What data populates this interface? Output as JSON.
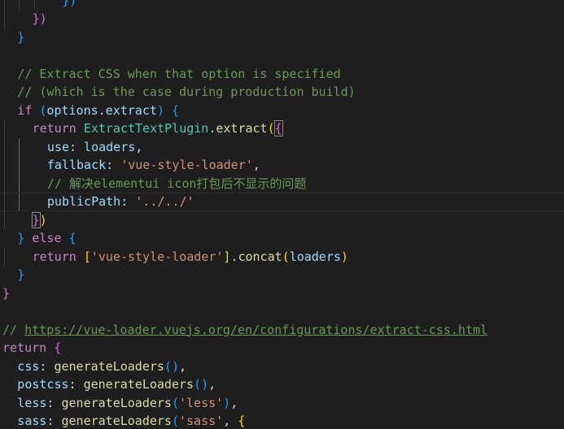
{
  "editor": {
    "language": "javascript",
    "colors": {
      "background": "#1e1e1e",
      "comment": "#6a9955",
      "keyword": "#c586c0",
      "variable": "#9cdcfe",
      "function": "#dcdcaa",
      "class": "#4ec9b0",
      "string": "#ce9178",
      "punctuation": "#d4d4d4",
      "bracket_level_1": "#ffd700",
      "bracket_level_2": "#da70d6",
      "bracket_level_3": "#179fff"
    },
    "lines": [
      {
        "indent": 4,
        "tokens": [
          {
            "t": "})",
            "c": "bracket3"
          }
        ]
      },
      {
        "indent": 2,
        "tokens": [
          {
            "t": "})",
            "c": "bracket2"
          }
        ]
      },
      {
        "indent": 1,
        "tokens": [
          {
            "t": "}",
            "c": "bracket3"
          }
        ]
      },
      {
        "indent": 0,
        "tokens": []
      },
      {
        "indent": 1,
        "tokens": [
          {
            "t": "// Extract CSS when that option is specified",
            "c": "comment"
          }
        ]
      },
      {
        "indent": 1,
        "tokens": [
          {
            "t": "// (which is the case during production build)",
            "c": "comment"
          }
        ]
      },
      {
        "indent": 1,
        "tokens": [
          {
            "t": "if",
            "c": "keyword"
          },
          {
            "t": " ",
            "c": "punct"
          },
          {
            "t": "(",
            "c": "bracket3"
          },
          {
            "t": "options",
            "c": "variable"
          },
          {
            "t": ".",
            "c": "punct"
          },
          {
            "t": "extract",
            "c": "variable"
          },
          {
            "t": ")",
            "c": "bracket3"
          },
          {
            "t": " ",
            "c": "punct"
          },
          {
            "t": "{",
            "c": "bracket3"
          }
        ]
      },
      {
        "indent": 2,
        "tokens": [
          {
            "t": "return",
            "c": "keyword"
          },
          {
            "t": " ",
            "c": "punct"
          },
          {
            "t": "ExtractTextPlugin",
            "c": "class"
          },
          {
            "t": ".",
            "c": "punct"
          },
          {
            "t": "extract",
            "c": "function"
          },
          {
            "t": "(",
            "c": "bracket1"
          },
          {
            "t": "{",
            "c": "bracket2",
            "m": true
          }
        ]
      },
      {
        "indent": 3,
        "tokens": [
          {
            "t": "use",
            "c": "variable"
          },
          {
            "t": ": ",
            "c": "punct"
          },
          {
            "t": "loaders",
            "c": "variable"
          },
          {
            "t": ",",
            "c": "punct"
          }
        ]
      },
      {
        "indent": 3,
        "tokens": [
          {
            "t": "fallback",
            "c": "variable"
          },
          {
            "t": ": ",
            "c": "punct"
          },
          {
            "t": "'vue-style-loader'",
            "c": "string"
          },
          {
            "t": ",",
            "c": "punct"
          }
        ]
      },
      {
        "indent": 3,
        "tokens": [
          {
            "t": "// 解决elementui icon打包后不显示的问题",
            "c": "comment"
          }
        ]
      },
      {
        "indent": 3,
        "current": true,
        "tokens": [
          {
            "t": "publicPath",
            "c": "variable"
          },
          {
            "t": ": ",
            "c": "punct"
          },
          {
            "t": "'../../'",
            "c": "string"
          }
        ]
      },
      {
        "indent": 2,
        "tokens": [
          {
            "t": "}",
            "c": "bracket2",
            "m": true
          },
          {
            "t": ")",
            "c": "bracket1"
          }
        ]
      },
      {
        "indent": 1,
        "tokens": [
          {
            "t": "}",
            "c": "bracket3"
          },
          {
            "t": " ",
            "c": "punct"
          },
          {
            "t": "else",
            "c": "keyword"
          },
          {
            "t": " ",
            "c": "punct"
          },
          {
            "t": "{",
            "c": "bracket3"
          }
        ]
      },
      {
        "indent": 2,
        "tokens": [
          {
            "t": "return",
            "c": "keyword"
          },
          {
            "t": " ",
            "c": "punct"
          },
          {
            "t": "[",
            "c": "bracket1"
          },
          {
            "t": "'vue-style-loader'",
            "c": "string"
          },
          {
            "t": "]",
            "c": "bracket1"
          },
          {
            "t": ".",
            "c": "punct"
          },
          {
            "t": "concat",
            "c": "function"
          },
          {
            "t": "(",
            "c": "bracket1"
          },
          {
            "t": "loaders",
            "c": "variable"
          },
          {
            "t": ")",
            "c": "bracket1"
          }
        ]
      },
      {
        "indent": 1,
        "tokens": [
          {
            "t": "}",
            "c": "bracket3"
          }
        ]
      },
      {
        "indent": 0,
        "tokens": [
          {
            "t": "}",
            "c": "bracket2"
          }
        ]
      },
      {
        "indent": 0,
        "tokens": []
      },
      {
        "indent": 0,
        "tokens": [
          {
            "t": "// ",
            "c": "comment"
          },
          {
            "t": "https://vue-loader.vuejs.org/en/configurations/extract-css.html",
            "c": "link"
          }
        ]
      },
      {
        "indent": 0,
        "tokens": [
          {
            "t": "return",
            "c": "keyword"
          },
          {
            "t": " ",
            "c": "punct"
          },
          {
            "t": "{",
            "c": "bracket2"
          }
        ]
      },
      {
        "indent": 1,
        "tokens": [
          {
            "t": "css",
            "c": "variable"
          },
          {
            "t": ": ",
            "c": "punct"
          },
          {
            "t": "generateLoaders",
            "c": "function"
          },
          {
            "t": "()",
            "c": "bracket3"
          },
          {
            "t": ",",
            "c": "punct"
          }
        ]
      },
      {
        "indent": 1,
        "tokens": [
          {
            "t": "postcss",
            "c": "variable"
          },
          {
            "t": ": ",
            "c": "punct"
          },
          {
            "t": "generateLoaders",
            "c": "function"
          },
          {
            "t": "()",
            "c": "bracket3"
          },
          {
            "t": ",",
            "c": "punct"
          }
        ]
      },
      {
        "indent": 1,
        "tokens": [
          {
            "t": "less",
            "c": "variable"
          },
          {
            "t": ": ",
            "c": "punct"
          },
          {
            "t": "generateLoaders",
            "c": "function"
          },
          {
            "t": "(",
            "c": "bracket3"
          },
          {
            "t": "'less'",
            "c": "string"
          },
          {
            "t": ")",
            "c": "bracket3"
          },
          {
            "t": ",",
            "c": "punct"
          }
        ]
      },
      {
        "indent": 1,
        "tokens": [
          {
            "t": "sass",
            "c": "variable"
          },
          {
            "t": ": ",
            "c": "punct"
          },
          {
            "t": "generateLoaders",
            "c": "function"
          },
          {
            "t": "(",
            "c": "bracket3"
          },
          {
            "t": "'sass'",
            "c": "string"
          },
          {
            "t": ", ",
            "c": "punct"
          },
          {
            "t": "{",
            "c": "bracket1"
          }
        ]
      }
    ]
  }
}
